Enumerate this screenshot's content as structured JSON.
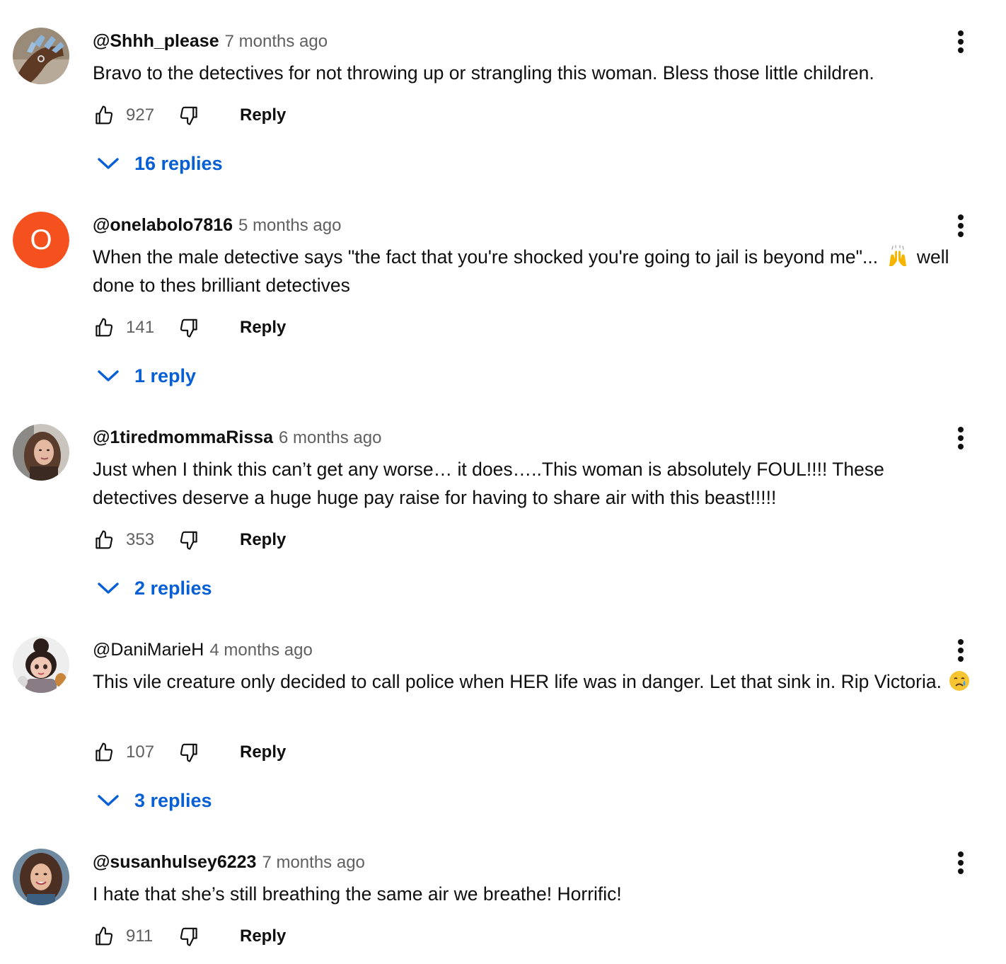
{
  "comments": [
    {
      "author": "@Shhh_please",
      "time": "7 months ago",
      "text": "Bravo to the detectives for not throwing up or strangling this woman. Bless those little children.",
      "likes": "927",
      "reply_label": "Reply",
      "replies_label": "16 replies"
    },
    {
      "author": "@onelabolo7816",
      "avatar_letter": "O",
      "avatar_color": "#f4511e",
      "time": "5 months ago",
      "text_before_emoji": "When the male detective says \"the fact that you're shocked you're going to jail is beyond me\"...",
      "text_after_emoji": "well done to thes brilliant detectives",
      "likes": "141",
      "reply_label": "Reply",
      "replies_label": "1 reply"
    },
    {
      "author": "@1tiredmommaRissa",
      "time": "6 months ago",
      "text": "Just when I think this can’t get any worse… it does…..This woman is absolutely FOUL!!!! These detectives deserve a huge huge pay raise for having to share air with this beast!!!!!",
      "likes": "353",
      "reply_label": "Reply",
      "replies_label": "2 replies"
    },
    {
      "author": "@DaniMarieH",
      "time": "4 months ago",
      "text": "This vile creature only decided to call police when HER life was in danger. Let that sink in. Rip Victoria.",
      "likes": "107",
      "reply_label": "Reply",
      "replies_label": "3 replies"
    },
    {
      "author": "@susanhulsey6223",
      "time": "7 months ago",
      "text": "I hate that she’s still breathing the same air we breathe! Horrific!",
      "likes": "911",
      "reply_label": "Reply"
    }
  ],
  "icons": {
    "like": "thumbs-up-icon",
    "dislike": "thumbs-down-icon",
    "menu": "more-vert-icon",
    "expand": "chevron-down-icon",
    "raising_hands": "raising-hands-emoji",
    "crying": "crying-face-emoji"
  },
  "colors": {
    "link_blue": "#065fd4",
    "secondary_text": "#606060",
    "primary_text": "#0f0f0f"
  }
}
